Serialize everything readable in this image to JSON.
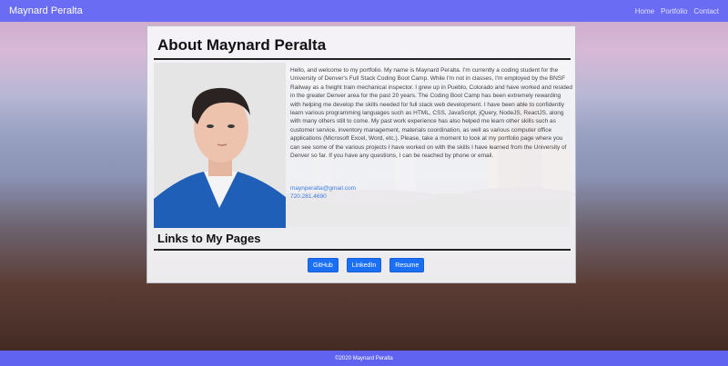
{
  "navbar": {
    "brand": "Maynard Peralta",
    "links": [
      "Home",
      "Portfolio",
      "Contact"
    ]
  },
  "about": {
    "title": "About Maynard Peralta",
    "bio": "Hello, and welcome to my portfolio. My name is Maynard Peralta. I'm currently a coding student for the University of Denver's Full Stack Coding Boot Camp. While I'm not in classes, I'm employed by the BNSF Railway as a freight train mechanical inspector. I grew up in Pueblo, Colorado and have worked and resided in the greater Denver area for the past 20 years. The Coding Boot Camp has been extremely rewarding with helping me develop the skills needed for full stack web development. I have been able to confidently learn various programming languages such as HTML, CSS, JavaScript, jQuery, NodeJS, ReactJS, along with many others still to come. My past work experience has also helped me learn other skills such as customer service, inventory management, materials coordination, as well as various computer office applications (Microsoft Excel, Word, etc.). Please, take a moment to look at my portfolio page where you can see some of the various projects I have worked on with the skills I have learned from the University of Denver so far. If you have any questions, I can be reached by phone or email.",
    "email": "maynperalta@gmail.com",
    "phone": "720.281.4690"
  },
  "links": {
    "title": "Links to My Pages",
    "buttons": [
      "GitHub",
      "LinkedIn",
      "Resume"
    ]
  },
  "footer": {
    "text": "©2020 Maynard Peralta"
  },
  "colors": {
    "navbar": "#6a6df3",
    "button": "#1a6ff5",
    "link": "#3a7be0"
  }
}
